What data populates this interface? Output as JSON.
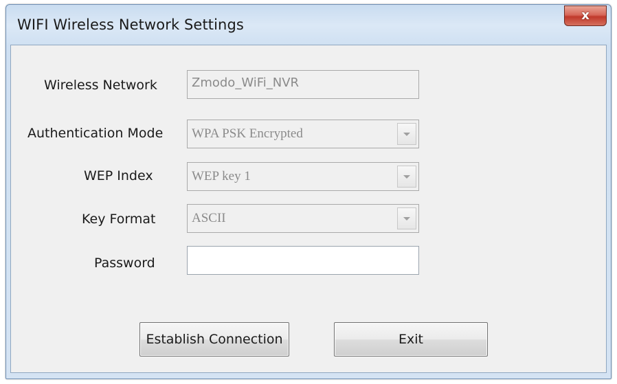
{
  "window": {
    "title": "WIFI Wireless Network Settings",
    "close_glyph": "x"
  },
  "form": {
    "wireless_network": {
      "label": "Wireless Network",
      "value": "Zmodo_WiFi_NVR"
    },
    "authentication_mode": {
      "label": "Authentication Mode",
      "value": "WPA PSK Encrypted"
    },
    "wep_index": {
      "label": "WEP Index",
      "value": "WEP key 1"
    },
    "key_format": {
      "label": "Key Format",
      "value": "ASCII"
    },
    "password": {
      "label": "Password",
      "value": ""
    }
  },
  "buttons": {
    "establish_connection": "Establish  Connection",
    "exit": "Exit"
  },
  "colors": {
    "title_bar": "#cfe0f2",
    "close_button": "#c0392b",
    "client_background": "#f0f0f0",
    "disabled_text": "#8a8a8a"
  },
  "icons": {
    "close": "close-icon",
    "dropdown": "chevron-down-icon"
  }
}
